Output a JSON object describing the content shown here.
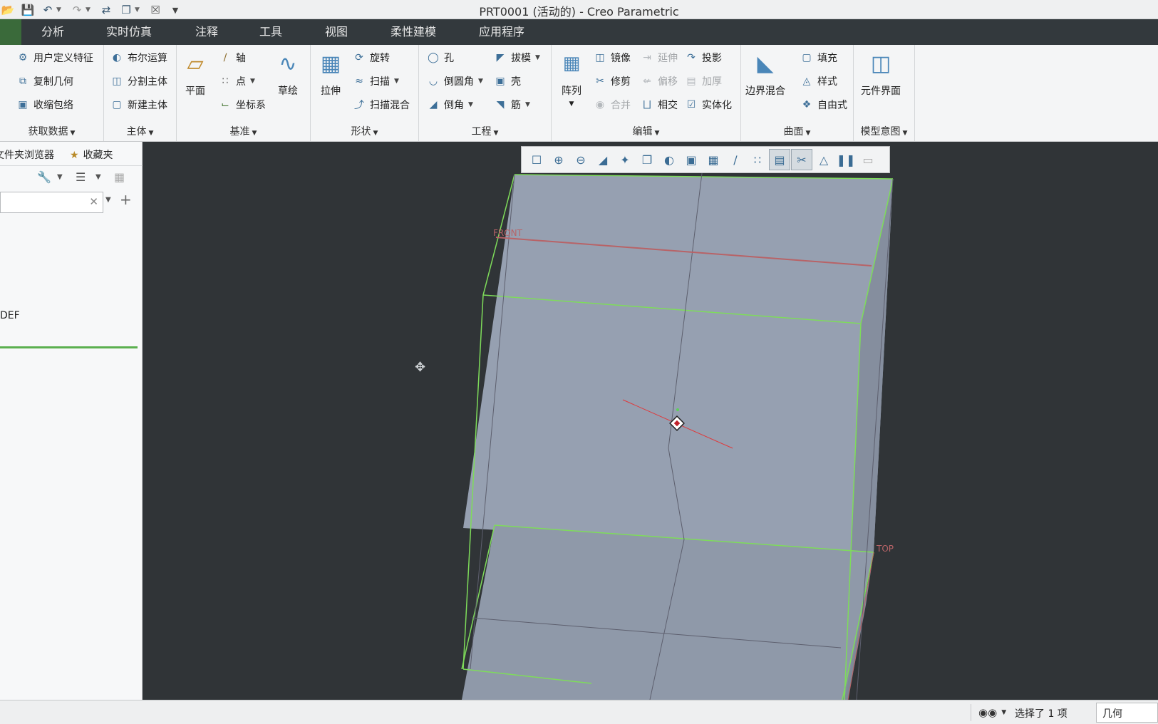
{
  "window": {
    "title": "PRT0001 (活动的) - Creo Parametric"
  },
  "quick_access": [
    {
      "name": "open-icon",
      "glyph": "📂"
    },
    {
      "name": "save-icon",
      "glyph": "💾"
    },
    {
      "name": "undo-icon",
      "glyph": "↶"
    },
    {
      "name": "redo-icon",
      "glyph": "↷"
    },
    {
      "name": "regenerate-icon",
      "glyph": "⇄"
    },
    {
      "name": "windows-icon",
      "glyph": "❐"
    },
    {
      "name": "close-window-icon",
      "glyph": "☒"
    }
  ],
  "tabs": [
    "分析",
    "实时仿真",
    "注释",
    "工具",
    "视图",
    "柔性建模",
    "应用程序"
  ],
  "ribbon": {
    "get_data": {
      "label": "获取数据",
      "items": [
        "用户定义特征",
        "复制几何",
        "收缩包络"
      ]
    },
    "body": {
      "label": "主体",
      "items": [
        "布尔运算",
        "分割主体",
        "新建主体"
      ]
    },
    "datum": {
      "label": "基准",
      "plane": "平面",
      "axis": "轴",
      "point": "点",
      "csys": "坐标系",
      "sketch": "草绘"
    },
    "shapes": {
      "label": "形状",
      "extrude": "拉伸",
      "revolve": "旋转",
      "sweep": "扫描",
      "swept_blend": "扫描混合"
    },
    "engineering": {
      "label": "工程",
      "hole": "孔",
      "round": "倒圆角",
      "chamfer": "倒角",
      "draft": "拔模",
      "shell": "壳",
      "rib": "筋"
    },
    "editing": {
      "label": "编辑",
      "pattern": "阵列",
      "mirror": "镜像",
      "extend": "延伸",
      "project": "投影",
      "trim": "修剪",
      "offset": "偏移",
      "thicken": "加厚",
      "merge": "合并",
      "intersect": "相交",
      "solidify": "实体化"
    },
    "surfaces": {
      "label": "曲面",
      "boundary_blend": "边界混合",
      "fill": "填充",
      "style": "样式",
      "freestyle": "自由式"
    },
    "model_intent": {
      "label": "模型意图",
      "component_interface": "元件界面"
    }
  },
  "left_panel": {
    "tab_folder": "文件夹浏览器",
    "tab_favorites": "收藏夹",
    "search_placeholder": "",
    "tree_item": "DEF"
  },
  "graphics_toolbar": [
    "refit-icon",
    "zoom-in-icon",
    "zoom-out-icon",
    "repaint-icon",
    "spin-center-icon",
    "display-style-icon",
    "saved-orientations-icon",
    "named-views-icon",
    "view-manager-icon",
    "perspective-icon",
    "datum-display-icon",
    "annotation-display-icon",
    "section-icon",
    "appearance-icon",
    "pause-icon",
    "hidden-icon"
  ],
  "viewport": {
    "datum_labels": {
      "front": "FRONT",
      "top": "TOP"
    }
  },
  "status": {
    "selection": "选择了 1 项",
    "filter": "几何"
  },
  "colors": {
    "edge_highlight": "#7edc5a",
    "datum_plane": "#c0585a",
    "model_face": "#96a0b0",
    "background": "#303437"
  }
}
